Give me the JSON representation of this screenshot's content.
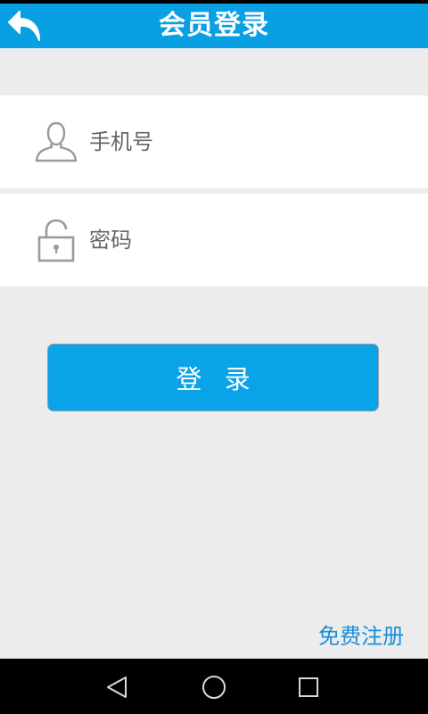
{
  "header": {
    "title": "会员登录",
    "back_icon": "back-arrow-icon",
    "background_color": "#09a0e3"
  },
  "form": {
    "phone": {
      "placeholder": "手机号",
      "value": "",
      "icon": "user-icon"
    },
    "password": {
      "placeholder": "密码",
      "value": "",
      "icon": "lock-icon"
    },
    "login_label": "登 录",
    "button_color": "#0ba3e8"
  },
  "footer": {
    "register_label": "免费注册",
    "link_color": "#1a8fd8"
  },
  "system_nav": {
    "back_icon": "nav-back-icon",
    "home_icon": "nav-home-icon",
    "recent_icon": "nav-recent-apps-icon"
  }
}
